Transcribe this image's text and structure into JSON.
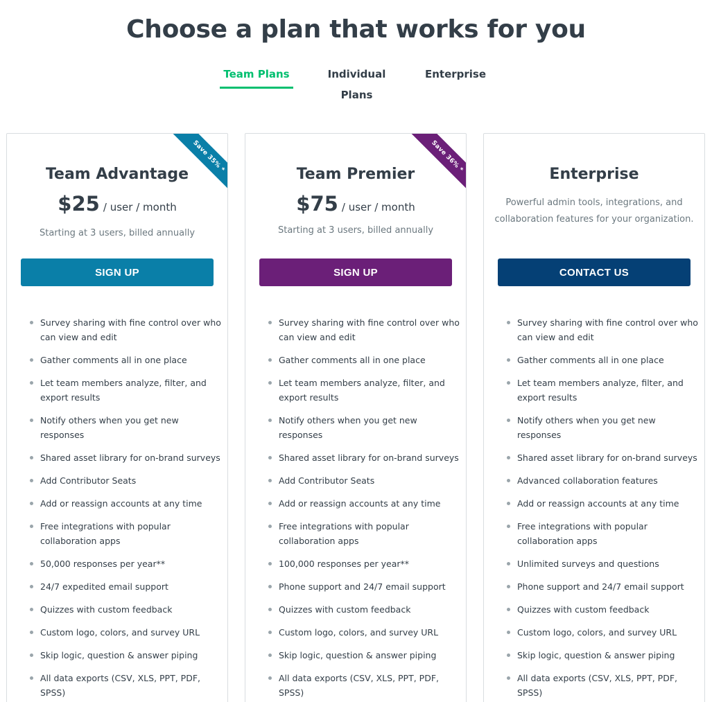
{
  "page": {
    "title": "Choose a plan that works for you"
  },
  "tabs": [
    {
      "label": "Team Plans"
    },
    {
      "label": "Individual Plans"
    },
    {
      "label": "Enterprise"
    }
  ],
  "colors": {
    "accent_green": "#00bf6f",
    "team_advantage": "#0a7fa8",
    "team_premier": "#6b1f78",
    "enterprise": "#054075"
  },
  "plans": [
    {
      "title": "Team Advantage",
      "ribbon": "Save 35% *",
      "price": "$25",
      "price_unit": "/ user / month",
      "billing": "Starting at 3 users, billed annually",
      "cta": "SIGN UP",
      "features": [
        "Survey sharing with fine control over who can view and edit",
        "Gather comments all in one place",
        "Let team members analyze, filter, and export results",
        "Notify others when you get new responses",
        "Shared asset library for on-brand surveys",
        "Add Contributor Seats",
        "Add or reassign accounts at any time",
        "Free integrations with popular collaboration apps",
        "50,000 responses per year**",
        "24/7 expedited email support",
        "Quizzes with custom feedback",
        "Custom logo, colors, and survey URL",
        "Skip logic, question & answer piping",
        "All data exports (CSV, XLS, PPT, PDF, SPSS)"
      ]
    },
    {
      "title": "Team Premier",
      "ribbon": "Save 36% *",
      "price": "$75",
      "price_unit": "/ user / month",
      "billing": "Starting at 3 users, billed annually",
      "cta": "SIGN UP",
      "features": [
        "Survey sharing with fine control over who can view and edit",
        "Gather comments all in one place",
        "Let team members analyze, filter, and export results",
        "Notify others when you get new responses",
        "Shared asset library for on-brand surveys",
        "Add Contributor Seats",
        "Add or reassign accounts at any time",
        "Free integrations with popular collaboration apps",
        "100,000 responses per year**",
        "Phone support and 24/7 email support",
        "Quizzes with custom feedback",
        "Custom logo, colors, and survey URL",
        "Skip logic, question & answer piping",
        "All data exports (CSV, XLS, PPT, PDF, SPSS)"
      ]
    },
    {
      "title": "Enterprise",
      "description": "Powerful admin tools, integrations, and collaboration features for your organization.",
      "cta": "CONTACT US",
      "features": [
        "Survey sharing with fine control over who can view and edit",
        "Gather comments all in one place",
        "Let team members analyze, filter, and export results",
        "Notify others when you get new responses",
        "Shared asset library for on-brand surveys",
        "Advanced collaboration features",
        "Add or reassign accounts at any time",
        "Free integrations with popular collaboration apps",
        "Unlimited surveys and questions",
        "Phone support and 24/7 email support",
        "Quizzes with custom feedback",
        "Custom logo, colors, and survey URL",
        "Skip logic, question & answer piping",
        "All data exports (CSV, XLS, PPT, PDF, SPSS)"
      ]
    }
  ]
}
